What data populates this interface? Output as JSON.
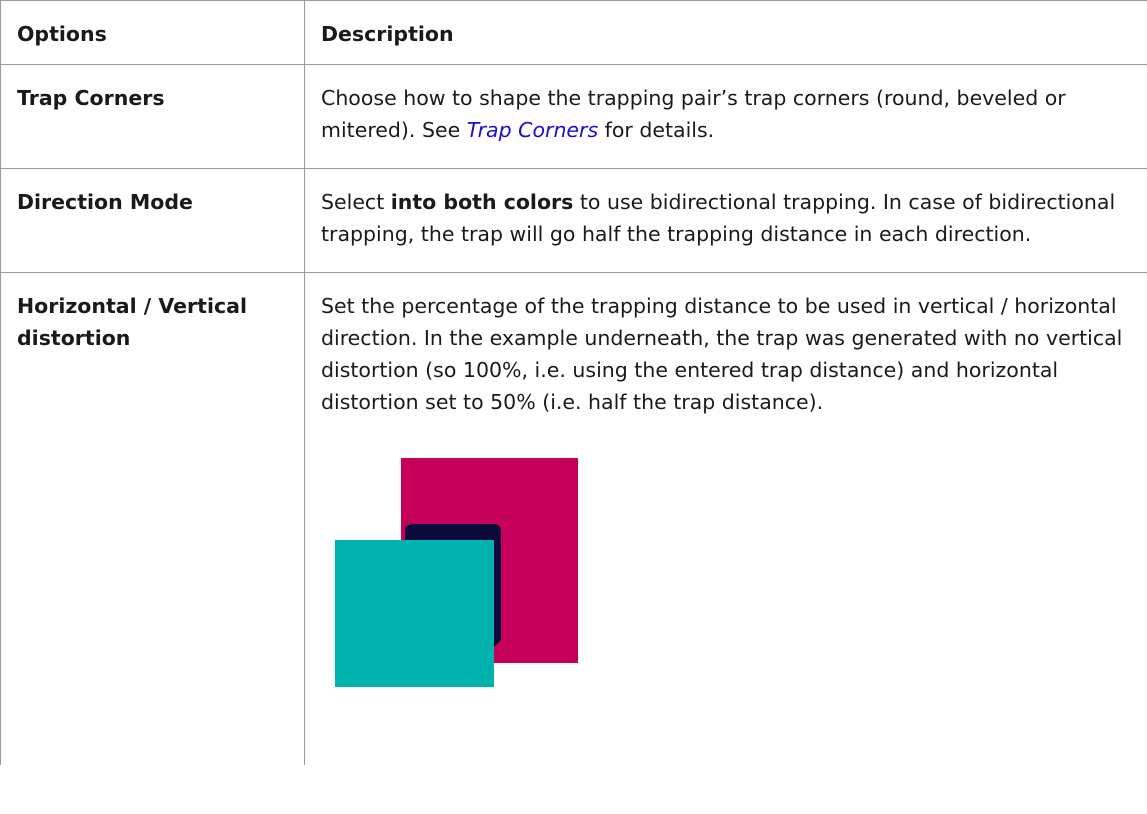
{
  "table": {
    "headers": {
      "options": "Options",
      "description": "Description"
    },
    "rows": [
      {
        "option": "Trap Corners",
        "desc_before_link": "Choose how to shape the trapping pair’s trap corners (round, beveled or mitered). See ",
        "link_text": "Trap Corners",
        "desc_after_link": " for details."
      },
      {
        "option": "Direction Mode",
        "desc_before_bold": "Select ",
        "bold_text": "into both colors",
        "desc_after_bold": " to use bidirectional trapping. In case of bidirectional trapping, the trap will go half the trapping distance in each direction."
      },
      {
        "option": "Horizontal / Vertical distortion",
        "desc": "Set the percentage of the trapping distance to be used in vertical / horizontal direction. In the example underneath, the trap was generated with no vertical distortion (so 100%, i.e. using the entered trap distance) and horizontal distortion set to 50% (i.e. half the trap distance)."
      }
    ]
  },
  "figure": {
    "colors": {
      "back_square": "#c4005a",
      "trap_shape": "#0a0a3a",
      "front_square": "#00b2ad"
    }
  }
}
